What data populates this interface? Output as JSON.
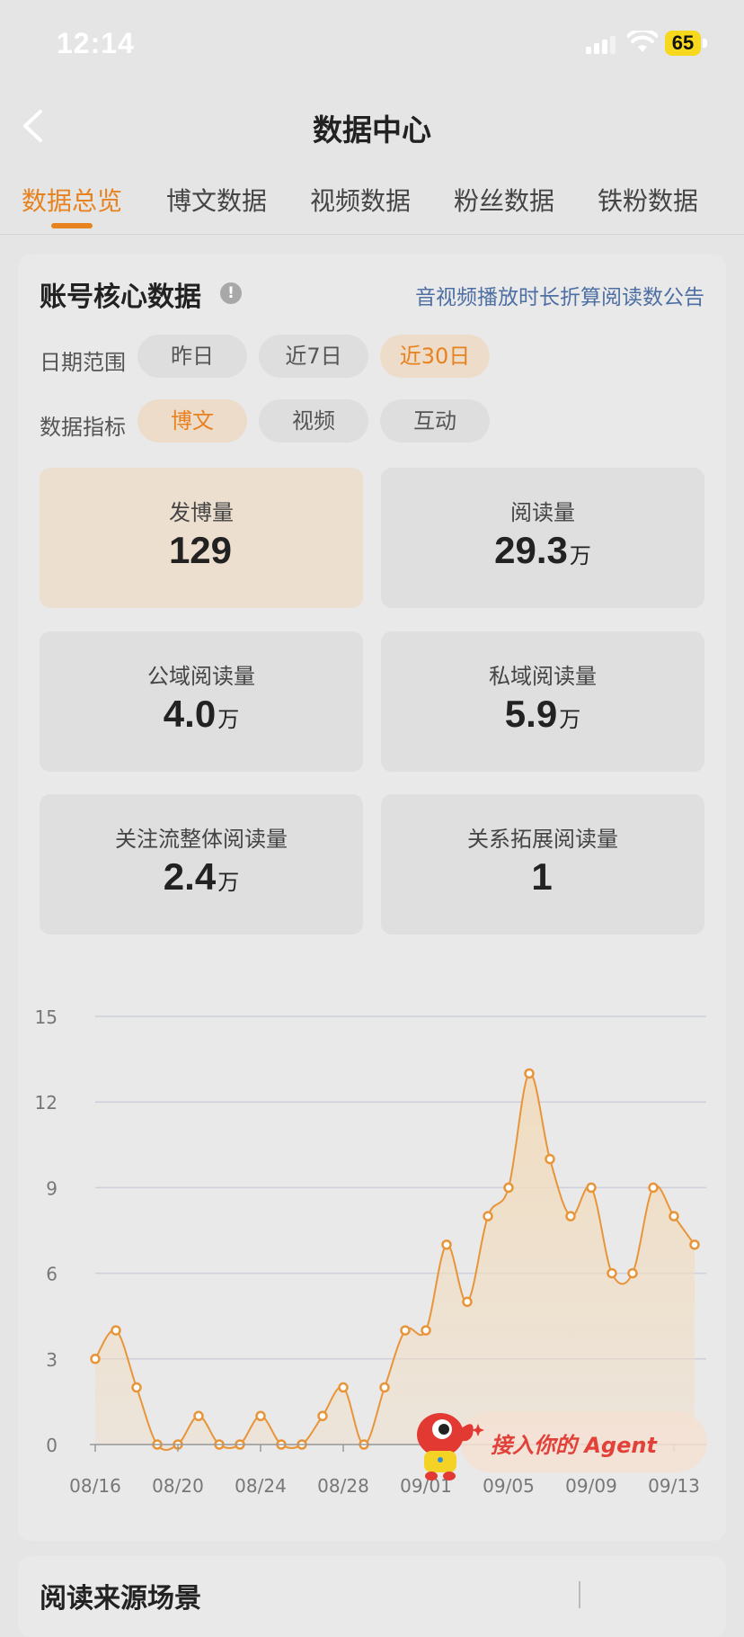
{
  "status_bar": {
    "time": "12:14",
    "battery": "65"
  },
  "nav": {
    "title": "数据中心"
  },
  "tabs": [
    {
      "label": "数据总览",
      "active": true
    },
    {
      "label": "博文数据",
      "active": false
    },
    {
      "label": "视频数据",
      "active": false
    },
    {
      "label": "粉丝数据",
      "active": false
    },
    {
      "label": "铁粉数据",
      "active": false
    }
  ],
  "core": {
    "title": "账号核心数据",
    "info_glyph": "!",
    "notice_link": "音视频播放时长折算阅读数公告",
    "date_range_label": "日期范围",
    "date_options": [
      "昨日",
      "近7日",
      "近30日"
    ],
    "date_selected": "近30日",
    "metric_label": "数据指标",
    "metric_options": [
      "博文",
      "视频",
      "互动"
    ],
    "metric_selected": "博文"
  },
  "metrics": [
    {
      "label": "发博量",
      "value": "129",
      "unit": "",
      "active": true
    },
    {
      "label": "阅读量",
      "value": "29.3",
      "unit": "万",
      "active": false
    },
    {
      "label": "公域阅读量",
      "value": "4.0",
      "unit": "万",
      "active": false
    },
    {
      "label": "私域阅读量",
      "value": "5.9",
      "unit": "万",
      "active": false
    },
    {
      "label": "关注流整体阅读量",
      "value": "2.4",
      "unit": "万",
      "active": false
    },
    {
      "label": "关系拓展阅读量",
      "value": "1",
      "unit": "",
      "active": false
    }
  ],
  "chart_data": {
    "type": "area",
    "x_tick_labels": [
      "08/16",
      "08/20",
      "08/24",
      "08/28",
      "09/01",
      "09/05",
      "09/09",
      "09/13"
    ],
    "y_ticks": [
      0,
      3,
      6,
      9,
      12,
      15
    ],
    "ylim": [
      0,
      15
    ],
    "grid": true,
    "color": "#e8953a",
    "fill": "#f1dcbf",
    "series": [
      {
        "values": [
          3,
          4,
          2,
          0,
          0,
          1,
          0,
          0,
          1,
          0,
          0,
          1,
          2,
          0,
          2,
          4,
          4,
          7,
          5,
          8,
          9,
          13,
          10,
          8,
          9,
          6,
          6,
          9,
          8,
          7
        ]
      }
    ]
  },
  "agent_button": {
    "label": "接入你的 Agent"
  },
  "next_section": {
    "title": "阅读来源场景"
  }
}
